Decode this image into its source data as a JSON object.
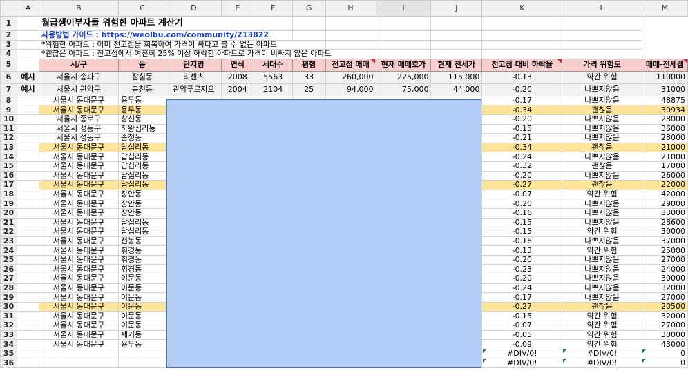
{
  "column_letters": [
    "A",
    "B",
    "C",
    "D",
    "E",
    "F",
    "G",
    "H",
    "I",
    "J",
    "K",
    "L",
    "M"
  ],
  "title": "월급쟁이부자들 위험한 아파트 계산기",
  "guide": "사용방법 가이드 : https://weolbu.com/community/213822",
  "note1": "*위험한 아파트 : 이미 전고점을 회복하여 가격이 싸다고 볼 수 없는 아파트",
  "note2": "*괜찮은 아파트 : 전고점에서 여전히 25% 이상 하락한 아파트로 가격이 비싸지 않은 아파트",
  "headers": [
    "시/구",
    "동",
    "단지명",
    "연식",
    "세대수",
    "평형",
    "전고점 매매",
    "현재 매매호가",
    "현재 전세가",
    "전고점 대비 하락율",
    "가격 위험도",
    "매매-전세갭"
  ],
  "examples": [
    {
      "label": "예시",
      "sigu": "서울시 송파구",
      "dong": "잠실동",
      "name": "리센츠",
      "year": "2008",
      "units": "5563",
      "size": "33",
      "peak": "260,000",
      "price": "225,000",
      "jeonse": "115,000",
      "drop": "-0.13",
      "risk": "약간 위험",
      "gap": "110000"
    },
    {
      "label": "예시",
      "sigu": "서울시 관악구",
      "dong": "봉천동",
      "name": "관악푸르지오",
      "year": "2004",
      "units": "2104",
      "size": "25",
      "peak": "94,000",
      "price": "75,000",
      "jeonse": "44,000",
      "drop": "-0.20",
      "risk": "나쁘지않음",
      "gap": "31000"
    }
  ],
  "rows": [
    {
      "sigu": "서울시 동대문구",
      "dong": "용두동",
      "drop": "-0.17",
      "risk": "나쁘지않음",
      "gap": "48875"
    },
    {
      "sigu": "서울시 동대문구",
      "dong": "용두동",
      "drop": "-0.34",
      "risk": "괜찮음",
      "gap": "30934",
      "good": true
    },
    {
      "sigu": "서울시 종로구",
      "dong": "창신동",
      "drop": "-0.20",
      "risk": "나쁘지않음",
      "gap": "28000"
    },
    {
      "sigu": "서울시 성동구",
      "dong": "하왕십리동",
      "drop": "-0.15",
      "risk": "나쁘지않음",
      "gap": "36000"
    },
    {
      "sigu": "서울시 성동구",
      "dong": "송정동",
      "drop": "-0.21",
      "risk": "나쁘지않음",
      "gap": "28000"
    },
    {
      "sigu": "서울시 동대문구",
      "dong": "답십리동",
      "drop": "-0.34",
      "risk": "괜찮음",
      "gap": "21000",
      "good": true
    },
    {
      "sigu": "서울시 동대문구",
      "dong": "답십리동",
      "drop": "-0.24",
      "risk": "나쁘지않음",
      "gap": "21000"
    },
    {
      "sigu": "서울시 동대문구",
      "dong": "답십리동",
      "drop": "-0.32",
      "risk": "괜찮음",
      "gap": "17000"
    },
    {
      "sigu": "서울시 동대문구",
      "dong": "답십리동",
      "drop": "-0.20",
      "risk": "나쁘지않음",
      "gap": "26000"
    },
    {
      "sigu": "서울시 동대문구",
      "dong": "답십리동",
      "drop": "-0.27",
      "risk": "괜찮음",
      "gap": "22000",
      "good": true
    },
    {
      "sigu": "서울시 동대문구",
      "dong": "장안동",
      "drop": "-0.07",
      "risk": "약간 위험",
      "gap": "42000"
    },
    {
      "sigu": "서울시 동대문구",
      "dong": "장안동",
      "drop": "-0.20",
      "risk": "나쁘지않음",
      "gap": "29000"
    },
    {
      "sigu": "서울시 동대문구",
      "dong": "장안동",
      "drop": "-0.16",
      "risk": "나쁘지않음",
      "gap": "33000"
    },
    {
      "sigu": "서울시 동대문구",
      "dong": "답십리동",
      "drop": "-0.15",
      "risk": "나쁘지않음",
      "gap": "28600"
    },
    {
      "sigu": "서울시 동대문구",
      "dong": "답십리동",
      "drop": "-0.15",
      "risk": "약간 위험",
      "gap": "30000"
    },
    {
      "sigu": "서울시 동대문구",
      "dong": "전농동",
      "drop": "-0.16",
      "risk": "나쁘지않음",
      "gap": "37000"
    },
    {
      "sigu": "서울시 동대문구",
      "dong": "휘경동",
      "drop": "-0.13",
      "risk": "약간 위험",
      "gap": "25000"
    },
    {
      "sigu": "서울시 동대문구",
      "dong": "휘경동",
      "drop": "-0.20",
      "risk": "나쁘지않음",
      "gap": "27000"
    },
    {
      "sigu": "서울시 동대문구",
      "dong": "휘경동",
      "drop": "-0.23",
      "risk": "나쁘지않음",
      "gap": "24000"
    },
    {
      "sigu": "서울시 동대문구",
      "dong": "이문동",
      "drop": "-0.20",
      "risk": "나쁘지않음",
      "gap": "30000"
    },
    {
      "sigu": "서울시 동대문구",
      "dong": "이문동",
      "drop": "-0.24",
      "risk": "나쁘지않음",
      "gap": "32000"
    },
    {
      "sigu": "서울시 동대문구",
      "dong": "이문동",
      "drop": "-0.17",
      "risk": "나쁘지않음",
      "gap": "27000"
    },
    {
      "sigu": "서울시 동대문구",
      "dong": "이문동",
      "drop": "-0.27",
      "risk": "괜찮음",
      "gap": "20500",
      "good": true
    },
    {
      "sigu": "서울시 동대문구",
      "dong": "이문동",
      "drop": "-0.15",
      "risk": "약간 위험",
      "gap": "32000"
    },
    {
      "sigu": "서울시 동대문구",
      "dong": "이문동",
      "drop": "-0.07",
      "risk": "약간 위험",
      "gap": "27000"
    },
    {
      "sigu": "서울시 동대문구",
      "dong": "제기동",
      "drop": "-0.05",
      "risk": "약간 위험",
      "gap": "30000"
    },
    {
      "sigu": "서울시 동대문구",
      "dong": "용두동",
      "drop": "-0.09",
      "risk": "약간 위험",
      "gap": "43000"
    }
  ],
  "error_rows": [
    {
      "drop": "#DIV/0!",
      "risk": "#DIV/0!",
      "gap": "0"
    },
    {
      "drop": "#DIV/0!",
      "risk": "#DIV/0!",
      "gap": "0"
    }
  ],
  "colors": {
    "header_fill": "#f8cecc",
    "good_fill": "#ffe59a",
    "overlay": "#b3cdf6",
    "link": "#1b3fc9"
  }
}
